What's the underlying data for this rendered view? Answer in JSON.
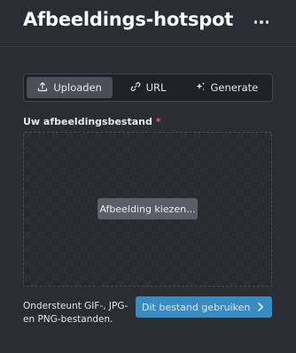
{
  "header": {
    "title": "Afbeeldings-hotspot",
    "more_icon": "more-horizontal-icon"
  },
  "tabs": [
    {
      "label": "Uploaden",
      "icon": "upload-icon",
      "active": true
    },
    {
      "label": "URL",
      "icon": "link-icon",
      "active": false
    },
    {
      "label": "Generate",
      "icon": "sparkle-icon",
      "active": false
    }
  ],
  "field": {
    "label": "Uw afbeeldingsbestand",
    "required_mark": "*"
  },
  "dropzone": {
    "choose_label": "Afbeelding kiezen..."
  },
  "footer": {
    "help_text": "Ondersteunt GIF-, JPG- en PNG-bestanden.",
    "use_label": "Dit bestand gebruiken",
    "use_icon": "chevron-right-icon"
  },
  "colors": {
    "background": "#2a2d33",
    "tab_active": "#4a4e56",
    "required": "#e0635c",
    "primary_button": "#3a8bc1"
  }
}
